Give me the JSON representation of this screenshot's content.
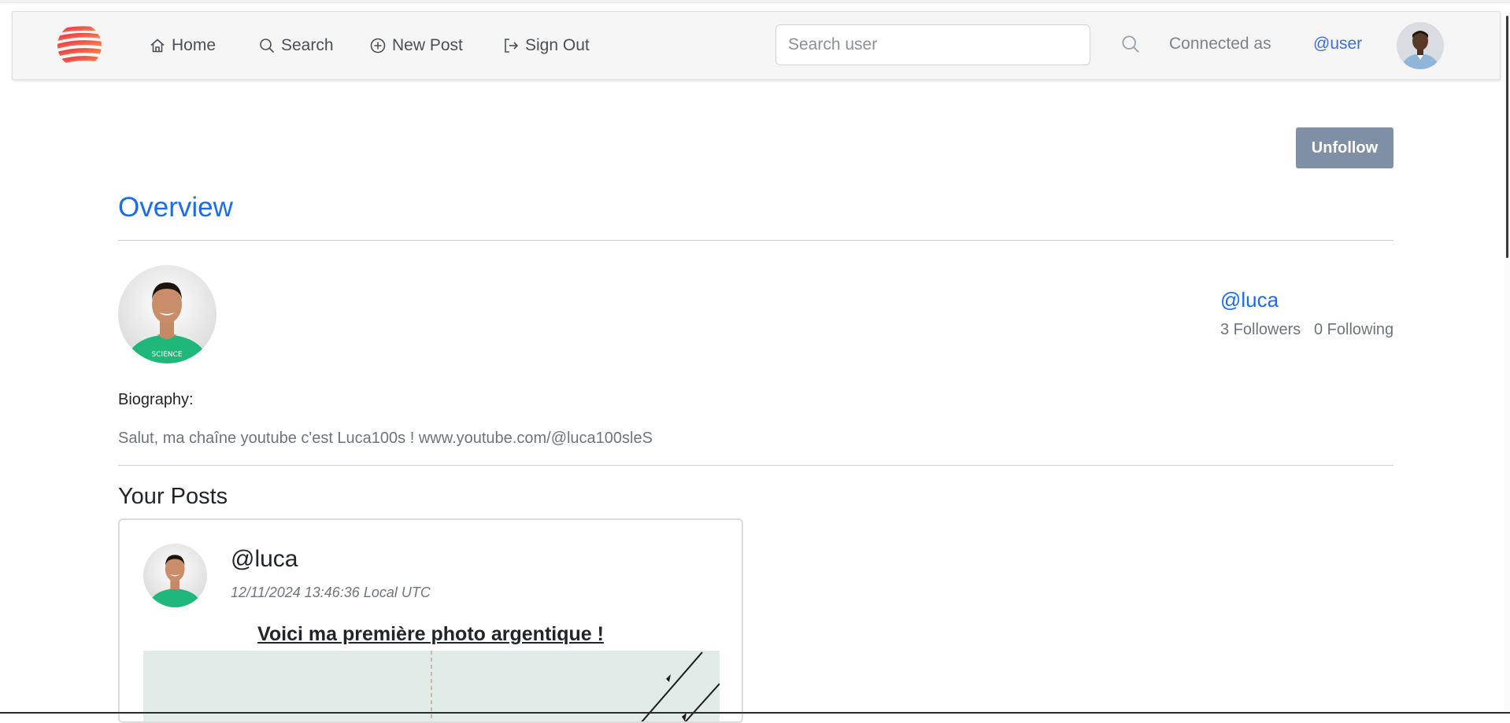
{
  "nav": {
    "items": [
      {
        "label": "Home",
        "icon": "home-icon"
      },
      {
        "label": "Search",
        "icon": "search-icon"
      },
      {
        "label": "New Post",
        "icon": "plus-circle-icon"
      },
      {
        "label": "Sign Out",
        "icon": "sign-out-icon"
      }
    ],
    "search_placeholder": "Search user",
    "connected_label": "Connected as",
    "current_user": "@user"
  },
  "profile": {
    "unfollow_label": "Unfollow",
    "section_title": "Overview",
    "handle": "@luca",
    "followers": "3 Followers",
    "following": "0 Following",
    "bio_label": "Biography:",
    "bio_text": "Salut, ma chaîne youtube c'est Luca100s ! www.youtube.com/@luca100sleS"
  },
  "posts": {
    "section_title": "Your Posts",
    "items": [
      {
        "author": "@luca",
        "date": "12/11/2024 13:46:36 Local UTC",
        "title": "Voici ma première photo argentique !"
      }
    ]
  },
  "colors": {
    "accent": "#1a6ce8",
    "button": "#7f8fa6",
    "logo_red": "#e8264a",
    "logo_orange": "#f58a3a"
  }
}
